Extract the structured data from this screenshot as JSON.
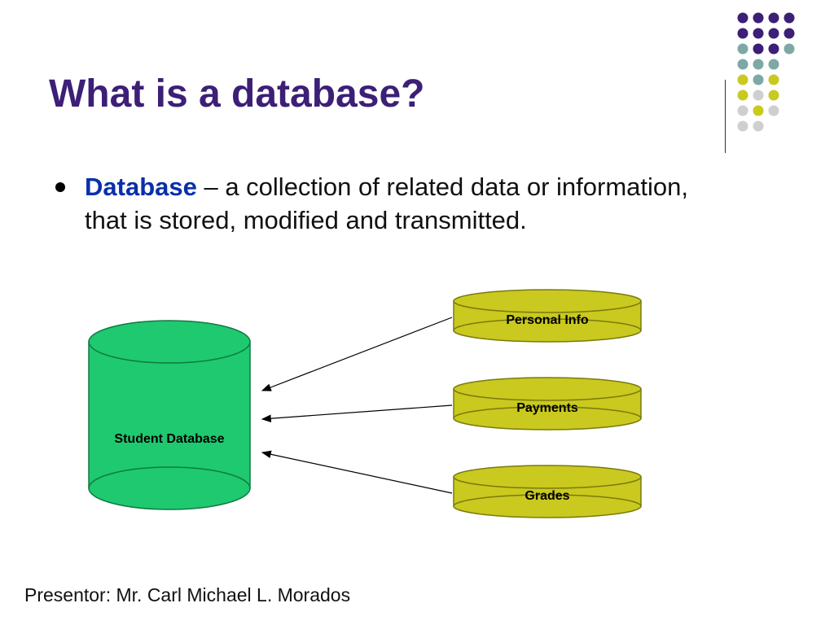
{
  "title": "What is a database?",
  "bullet": {
    "term": "Database",
    "definition": " – a collection of related data or information, that is stored, modified and transmitted."
  },
  "diagram": {
    "main_cylinder": "Student Database",
    "items": [
      "Personal Info",
      "Payments",
      "Grades"
    ]
  },
  "presenter": "Presentor:  Mr. Carl Michael L. Morados",
  "colors": {
    "title": "#3c1f77",
    "term": "#0a2faa",
    "main_fill": "#1fc96f",
    "main_stroke": "#0e7a43",
    "item_fill": "#c9c91f",
    "item_stroke": "#7a7a0e"
  },
  "deco_dots": {
    "rows": [
      [
        "#3c1f77",
        "#3c1f77",
        "#3c1f77",
        "#3c1f77"
      ],
      [
        "#3c1f77",
        "#3c1f77",
        "#3c1f77",
        "#3c1f77"
      ],
      [
        "#7da8a6",
        "#3c1f77",
        "#3c1f77",
        "#7da8a6"
      ],
      [
        "#7da8a6",
        "#7da8a6",
        "#7da8a6",
        "none"
      ],
      [
        "#c9c91f",
        "#7da8a6",
        "#c9c91f",
        "none"
      ],
      [
        "#c9c91f",
        "#cfcfcf",
        "#c9c91f",
        "none"
      ],
      [
        "#cfcfcf",
        "#c9c91f",
        "#cfcfcf",
        "none"
      ],
      [
        "#cfcfcf",
        "#cfcfcf",
        "none",
        "none"
      ]
    ],
    "radius": 6.5,
    "spacing": 19
  }
}
